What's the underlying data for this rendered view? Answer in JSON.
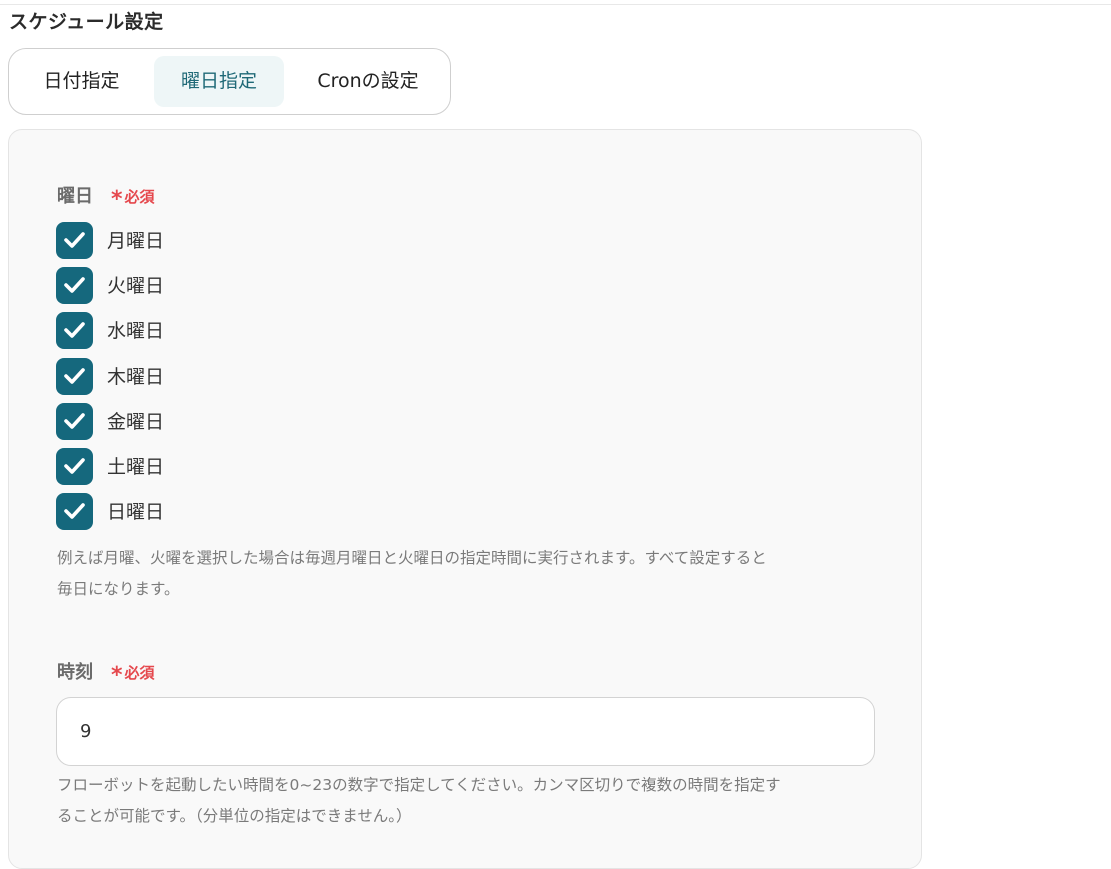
{
  "section_title": "スケジュール設定",
  "tabs": [
    {
      "label": "日付指定",
      "active": false
    },
    {
      "label": "曜日指定",
      "active": true
    },
    {
      "label": "Cronの設定",
      "active": false
    }
  ],
  "weekday_field": {
    "label": "曜日",
    "required_mark": "*",
    "required_label": "必須",
    "options": [
      {
        "label": "月曜日",
        "checked": true
      },
      {
        "label": "火曜日",
        "checked": true
      },
      {
        "label": "水曜日",
        "checked": true
      },
      {
        "label": "木曜日",
        "checked": true
      },
      {
        "label": "金曜日",
        "checked": true
      },
      {
        "label": "土曜日",
        "checked": true
      },
      {
        "label": "日曜日",
        "checked": true
      }
    ],
    "help_line1": "例えば月曜、火曜を選択した場合は毎週月曜日と火曜日の指定時間に実行されます。すべて設定すると",
    "help_line2": "毎日になります。"
  },
  "time_field": {
    "label": "時刻",
    "required_mark": "*",
    "required_label": "必須",
    "value": "9",
    "help_line1": "フローボットを起動したい時間を0~23の数字で指定してください。カンマ区切りで複数の時間を指定す",
    "help_line2": "ることが可能です。（分単位の指定はできません。）"
  },
  "colors": {
    "checkbox_fill": "#15687d",
    "required": "#e5484d",
    "active_tab_bg": "#eef6f7",
    "active_tab_text": "#1f6977"
  }
}
